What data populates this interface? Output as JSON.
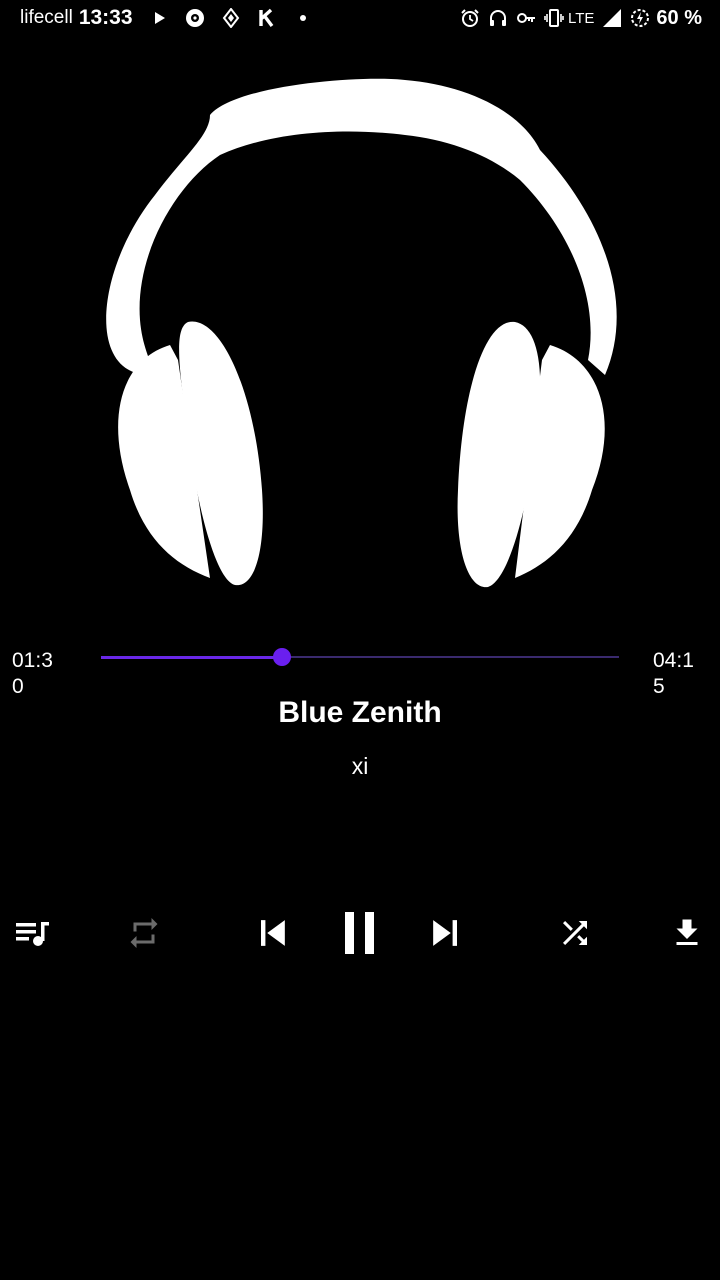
{
  "status_bar": {
    "carrier": "lifecell",
    "time": "13:33",
    "network": "LTE",
    "battery": "60 %",
    "left_icons": [
      "play-notification-icon",
      "disc-notification-icon",
      "diamond-app-icon",
      "k-app-icon",
      "more-dot-icon"
    ],
    "right_icons": [
      "alarm-icon",
      "headphones-icon",
      "key-icon",
      "vibrate-icon",
      "signal-icon",
      "battery-saver-icon"
    ]
  },
  "artwork": {
    "icon": "headphones-artwork"
  },
  "player": {
    "elapsed": "01:30",
    "total": "04:15",
    "progress": 0.35,
    "accent_color": "#6a1fef",
    "title": "Blue Zenith",
    "artist": "xi"
  },
  "controls": {
    "playlist": "queue-music-icon",
    "repeat": "repeat-icon",
    "repeat_enabled": false,
    "previous": "skip-previous-icon",
    "play_pause": "pause-icon",
    "next": "skip-next-icon",
    "shuffle": "shuffle-icon",
    "download": "download-icon"
  }
}
